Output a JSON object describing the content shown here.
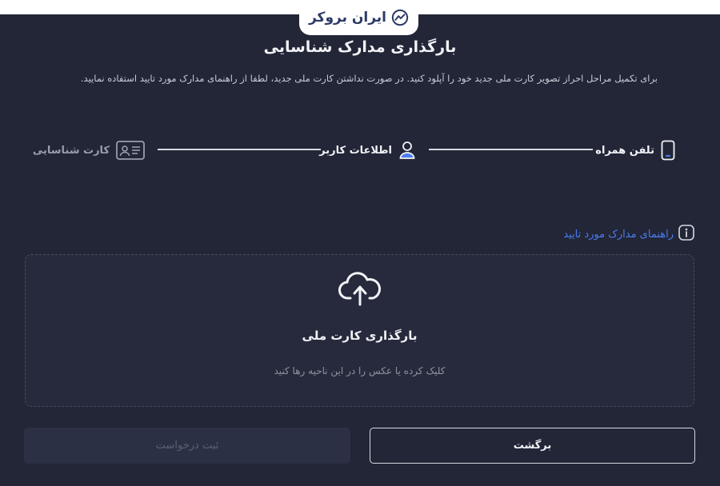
{
  "brand": {
    "name": "ایران بروکر",
    "icon": "chart-line-icon",
    "color": "#2c3a66"
  },
  "page": {
    "title": "بارگذاری مدارک شناسایی",
    "description": "برای تکمیل مراحل احراز تصویر کارت ملی جدید خود را آپلود کنید. در صورت نداشتن کارت ملی جدید، لطفا از راهنمای مدارک مورد تایید استفاده نمایید."
  },
  "steps": [
    {
      "label": "تلفن همراه",
      "icon": "mobile-phone-icon",
      "state": "done"
    },
    {
      "label": "اطلاعات کاربر",
      "icon": "user-icon",
      "state": "done"
    },
    {
      "label": "کارت شناسایی",
      "icon": "id-card-icon",
      "state": "inactive"
    }
  ],
  "guide": {
    "label": "راهنمای مدارک مورد تایید",
    "icon": "info-icon",
    "color": "#4d7cf0"
  },
  "upload": {
    "icon": "cloud-upload-icon",
    "title": "بارگذاری کارت ملی",
    "hint": "کلیک کرده یا عکس را در این ناحیه رها کنید"
  },
  "actions": {
    "submit_label": "ثبت درخواست",
    "back_label": "برگشت"
  },
  "colors": {
    "background": "#222637",
    "accent": "#4d7cf0",
    "active_step": "#4d7cf0"
  }
}
